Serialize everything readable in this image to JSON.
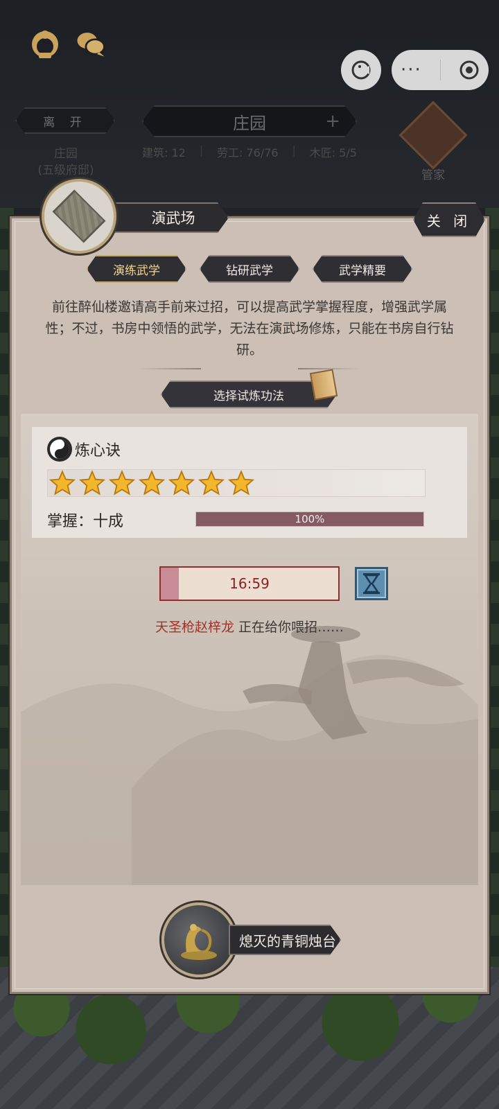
{
  "header": {
    "leave_label": "离 开",
    "location_name": "庄园",
    "location_sub": "(五级府邸)",
    "estate_title": "庄园",
    "plus_symbol": "+",
    "stats": {
      "buildings": "建筑: 12",
      "labor": "劳工: 76/76",
      "carpenter": "木匠: 5/5"
    },
    "butler_label": "管家",
    "capsule_dots": "···"
  },
  "panel": {
    "scene_title": "演武场",
    "close_label": "关 闭",
    "tabs": [
      {
        "label": "演练武学",
        "active": true
      },
      {
        "label": "钻研武学",
        "active": false
      },
      {
        "label": "武学精要",
        "active": false
      }
    ],
    "description": "前往醉仙楼邀请高手前来过招，可以提高武学掌握程度，增强武学属性；不过，书房中领悟的武学，无法在演武场修炼，只能在书房自行钻研。",
    "choose_label": "选择试炼功法"
  },
  "skill": {
    "name": "炼心诀",
    "stars": 7,
    "mastery_label": "掌握：十成",
    "progress_fraction": 1.0,
    "progress_text": "100%"
  },
  "timer": {
    "time": "16:59",
    "fill_fraction": 0.1
  },
  "status": {
    "who": "天圣枪赵梓龙",
    "action": " 正在给你喂招……"
  },
  "item": {
    "label": "熄灭的青铜烛台"
  },
  "colors": {
    "panel_bg": "#cbbfb6",
    "progress_fill": "#845a63",
    "timer_text": "#8d1f1f",
    "status_name": "#a33228",
    "active_tab_text": "#f3d78e"
  }
}
